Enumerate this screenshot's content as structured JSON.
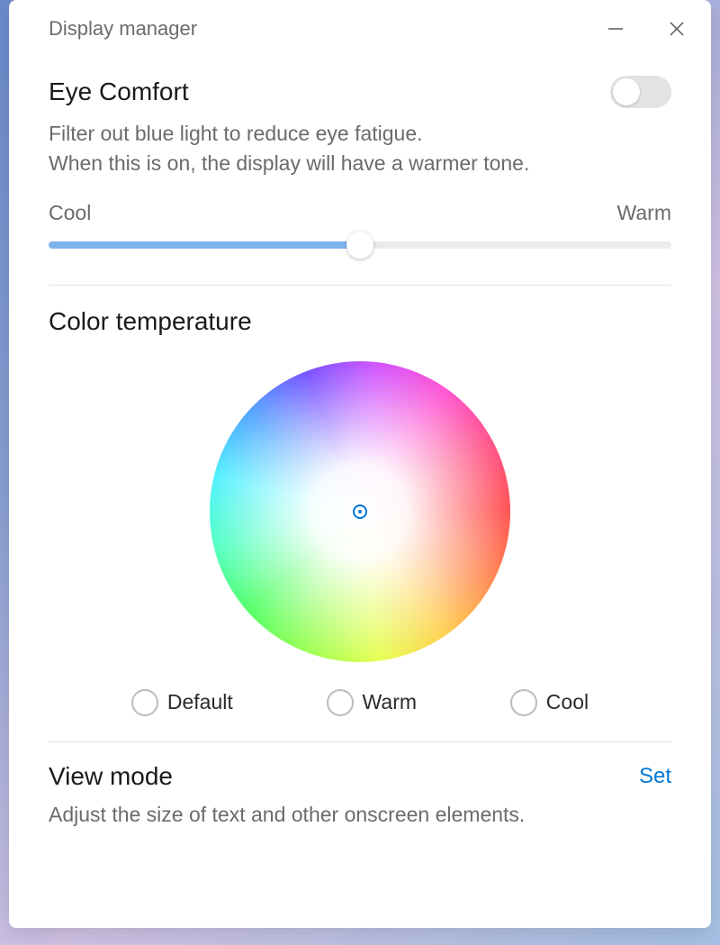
{
  "window": {
    "title": "Display manager"
  },
  "eyeComfort": {
    "title": "Eye Comfort",
    "description": "Filter out blue light to reduce eye fatigue.\nWhen this is on, the display will have a warmer tone.",
    "toggle": false,
    "slider": {
      "leftLabel": "Cool",
      "rightLabel": "Warm",
      "valuePercent": 50
    }
  },
  "colorTemp": {
    "title": "Color temperature",
    "options": [
      {
        "label": "Default"
      },
      {
        "label": "Warm"
      },
      {
        "label": "Cool"
      }
    ]
  },
  "viewMode": {
    "title": "View mode",
    "setLabel": "Set",
    "description": "Adjust the size of text and other onscreen elements."
  }
}
